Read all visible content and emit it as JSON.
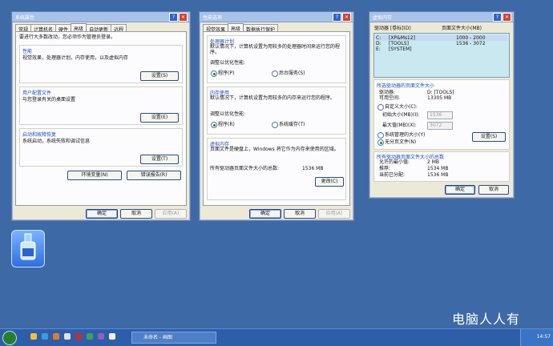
{
  "window1": {
    "title": "系统属性",
    "tabs": [
      "常规",
      "计算机名",
      "硬件",
      "高级",
      "自动更新",
      "远程"
    ],
    "intro": "要进行大多数改动，您必须作为管理员登录。",
    "perf_title": "性能",
    "perf_desc": "视觉效果，处理器计划，内存使用，以及虚拟内存",
    "profile_title": "用户配置文件",
    "profile_desc": "与您登录有关的桌面设置",
    "startup_title": "启动和故障恢复",
    "startup_desc": "系统启动，系统失败和调试信息",
    "settings_btn": "设置(S)",
    "settings_btn2": "设置(E)",
    "settings_btn3": "设置(T)",
    "env_btn": "环境变量(N)",
    "err_btn": "错误报告(R)",
    "ok": "确定",
    "cancel": "取消",
    "apply": "应用(A)"
  },
  "window2": {
    "title": "性能选项",
    "tabs": [
      "视觉效果",
      "高级",
      "数据执行保护"
    ],
    "sched_title": "处理器计划",
    "sched_desc": "默认情况下，计算机设置为用较多的处理器时间来运行您的程序。",
    "adjust_label": "调整以优化性能:",
    "radio_programs": "程序(P)",
    "radio_services": "后台服务(S)",
    "mem_title": "内存使用",
    "mem_desc": "默认情况下，计算机设置为用较多的内存来运行您的程序。",
    "adjust_label2": "调整以优化性能:",
    "radio_programs2": "程序(R)",
    "radio_cache": "系统缓存(T)",
    "vm_title": "虚拟内存",
    "vm_desc": "页面文件是硬盘上，Windows 将它作为内存来使用的区域。",
    "vm_total_label": "所有驱动器页面文件大小的总数:",
    "vm_total_value": "1536 MB",
    "change_btn": "更改(C)",
    "ok": "确定",
    "cancel": "取消",
    "apply": "应用(A)"
  },
  "window3": {
    "title": "虚拟内存",
    "col_drive": "驱动器 [卷标](D)",
    "col_size": "页面文件大小(MB)",
    "drives": [
      {
        "name": "C:",
        "label": "[XP&Ms12]",
        "size": "1000 - 2000"
      },
      {
        "name": "D:",
        "label": "[TOOLS]",
        "size": "1536 - 3072"
      },
      {
        "name": "E:",
        "label": "[SYSTEM]",
        "size": ""
      }
    ],
    "sel_title": "所选驱动器的页面文件大小",
    "drive_label": "驱动器:",
    "drive_value": "D:  [TOOLS]",
    "free_label": "可用空间:",
    "free_value": "13305 MB",
    "custom_radio": "自定义大小(C):",
    "initial_label": "初始大小(MB)(I):",
    "initial_value": "1536",
    "max_label": "最大值(MB)(X):",
    "max_value": "3072",
    "managed_radio": "系统管理的大小(Y)",
    "nopage_radio": "无分页文件(N)",
    "set_btn": "设置(S)",
    "total_title": "所有驱动器页面文件大小的总数",
    "min_label": "允许的最小值:",
    "min_value": "2 MB",
    "rec_label": "推荐:",
    "rec_value": "1534 MB",
    "cur_label": "当前已分配:",
    "cur_value": "1536 MB",
    "ok": "确定",
    "cancel": "取消"
  },
  "taskbar": {
    "task_label": "未命名 - 画图",
    "clock": "14:57"
  },
  "watermark": "电脑人人有"
}
